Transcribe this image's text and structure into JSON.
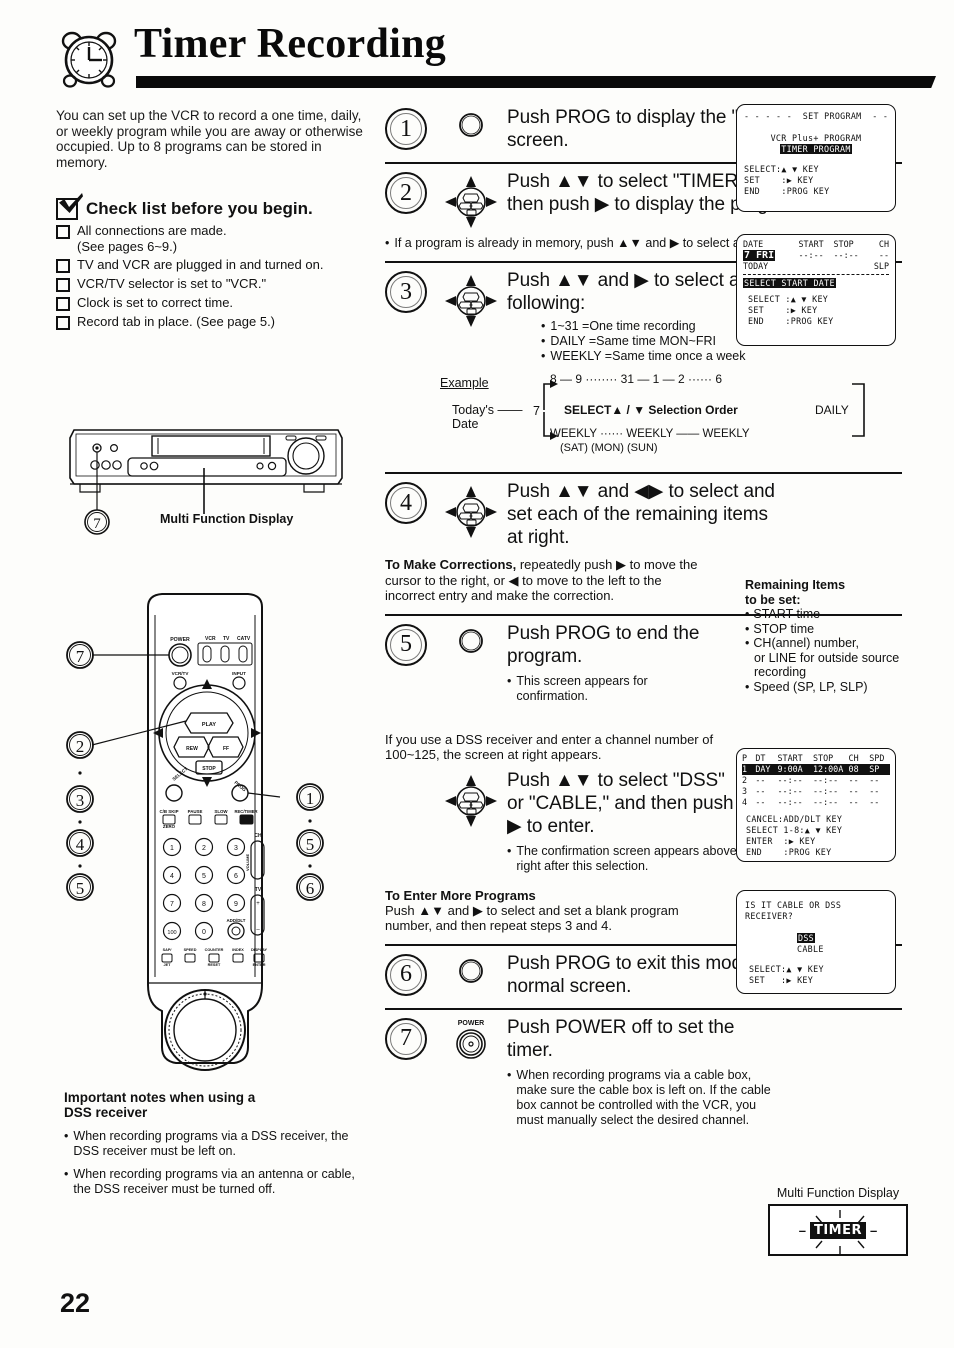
{
  "header": {
    "title": "Timer Recording",
    "icon": "alarm-clock-icon"
  },
  "intro": {
    "paragraph": "You can set up the VCR to record a one time, daily, or weekly program while you are away or otherwise occupied. Up to 8 programs can be stored in memory."
  },
  "checklist": {
    "title": "Check list before you begin.",
    "items": [
      {
        "label": "All connections are made.",
        "sub": "(See pages 6~9.)"
      },
      {
        "label": "TV and VCR are plugged in and turned on.",
        "sub": ""
      },
      {
        "label": "VCR/TV selector is set to \"VCR.\"",
        "sub": ""
      },
      {
        "label": "Clock is set to correct time.",
        "sub": ""
      },
      {
        "label": "Record tab in place. (See page 5.)",
        "sub": ""
      }
    ]
  },
  "vcr_illustration": {
    "callout_label": "Multi Function Display",
    "callout_number": "7"
  },
  "remote_illustration": {
    "callouts": [
      "7",
      "2",
      "3",
      "4",
      "5",
      "1",
      "5",
      "6"
    ],
    "button_labels": [
      "POWER",
      "VCR",
      "TV",
      "CATV",
      "VCR/TV",
      "INPUT",
      "PLAY",
      "REW",
      "FF",
      "STOP",
      "SELECT",
      "PROG",
      "C/B SKIP ZERO",
      "PAUSE",
      "SLOW",
      "REC/TIMER",
      "CH",
      "VOLUME",
      "TV",
      "ADD/DLT",
      "SAP/JET",
      "SPEED",
      "COUNTER RESET",
      "INDEX",
      "DISPLAY ENTER"
    ],
    "keypad": [
      "1",
      "2",
      "3",
      "4",
      "5",
      "6",
      "7",
      "8",
      "9",
      "100",
      "0"
    ]
  },
  "important_notes": {
    "title_line1": "Important notes when using a",
    "title_line2": "DSS receiver",
    "items": [
      "When recording programs via a DSS receiver, the DSS receiver must be left on.",
      "When recording programs via an antenna or cable, the DSS receiver must be turned off."
    ]
  },
  "page_number": "22",
  "steps": [
    {
      "number": "1",
      "icon": "prog-button-icon",
      "heading": "Push PROG to display the \"SET PROGRAM\" screen."
    },
    {
      "number": "2",
      "icon": "dpad-icon",
      "heading": "Push ▲▼ to select \"TIMER PROGRAM,\" and then push ▶ to display the program screen.",
      "note": "If a program is already in memory, push ▲▼ and ▶ to select an unused program number."
    },
    {
      "number": "3",
      "icon": "dpad-icon",
      "heading": "Push ▲▼ and ▶ to select and set one of the following:",
      "bullets": [
        "1~31 =One time recording",
        "DAILY =Same time MON~FRI",
        "WEEKLY =Same time once a week"
      ],
      "example": {
        "label": "Example",
        "todays_date_line1": "Today's",
        "todays_date_line2": "Date",
        "start_value": "7",
        "top_sequence": "8 — 9 ········ 31 — 1 — 2 ······ 6",
        "middle_label": "SELECT▲ / ▼ Selection Order",
        "daily_label": "DAILY",
        "bottom_sequence": "WEEKLY ······ WEEKLY —— WEEKLY",
        "bottom_sequence_sub": "(SAT)              (MON)            (SUN)"
      }
    },
    {
      "number": "4",
      "icon": "dpad-icon",
      "heading": "Push ▲▼ and ◀▶ to select and set each of the remaining items at right.",
      "correction_bold": "To Make Corrections,",
      "correction_text": " repeatedly push ▶ to move the cursor to the right, or ◀ to move to the left to the incorrect entry and make the correction."
    },
    {
      "number": "5",
      "icon": "prog-button-icon",
      "heading": "Push PROG to end the program.",
      "note": "This screen appears for confirmation.",
      "dss_paragraph": "If you use a DSS receiver and enter a channel number of 100~125, the screen at right appears.",
      "dss_heading": "Push ▲▼ to select \"DSS\" or \"CABLE,\" and then push ▶ to enter.",
      "dss_note": "The confirmation screen appears above right after this selection.",
      "more_programs_title": "To Enter More Programs",
      "more_programs_text": "Push ▲▼ and ▶ to select and set a blank program number, and then repeat steps 3 and 4."
    },
    {
      "number": "6",
      "icon": "prog-button-icon",
      "heading": "Push PROG to exit this mode and return to the normal screen."
    },
    {
      "number": "7",
      "icon": "power-button-icon",
      "icon_label": "POWER",
      "heading": "Push POWER off to set the timer.",
      "note": "When recording programs via a cable box, make sure the cable box is left on. If the cable box cannot be controlled with the VCR, you must manually select the desired channel."
    }
  ],
  "remaining_items": {
    "title_line1": "Remaining Items",
    "title_line2": "to be set:",
    "items": [
      {
        "text": "START time",
        "cont": ""
      },
      {
        "text": "STOP time",
        "cont": ""
      },
      {
        "text": "CH(annel) number,",
        "cont": "or LINE for outside source recording"
      },
      {
        "text": "Speed (SP, LP, SLP)",
        "cont": ""
      }
    ]
  },
  "osd_set_program": {
    "title": "- - - - -  SET PROGRAM  - - - - -",
    "option_1": "VCR Plus+ PROGRAM",
    "option_2_highlighted": "TIMER PROGRAM",
    "keys": [
      "SELECT:▲ ▼ KEY",
      "SET    :▶ KEY",
      "END    :PROG KEY"
    ]
  },
  "osd_date_screen": {
    "columns": [
      "DATE",
      "START",
      "STOP",
      "CH"
    ],
    "row_date_highlighted": "7 FRI",
    "row_start": "--:--",
    "row_stop": "--:--",
    "row_ch": "--",
    "today_label": "TODAY",
    "speed": "SLP",
    "status_highlighted": "SELECT START DATE",
    "keys": [
      "SELECT :▲ ▼ KEY",
      "SET    :▶ KEY",
      "END    :PROG KEY"
    ]
  },
  "osd_program_list": {
    "columns": [
      "P",
      "DT",
      "START",
      "STOP",
      "CH",
      "SPD"
    ],
    "rows": [
      {
        "p": "1",
        "dt": "DAY",
        "start": "9:00A",
        "stop": "12:00A",
        "ch": "08",
        "spd": "SP",
        "highlighted": true
      },
      {
        "p": "2",
        "dt": "--",
        "start": "--:--",
        "stop": "--:--",
        "ch": "--",
        "spd": "--",
        "highlighted": false
      },
      {
        "p": "3",
        "dt": "--",
        "start": "--:--",
        "stop": "--:--",
        "ch": "--",
        "spd": "--",
        "highlighted": false
      },
      {
        "p": "4",
        "dt": "--",
        "start": "--:--",
        "stop": "--:--",
        "ch": "--",
        "spd": "--",
        "highlighted": false
      }
    ],
    "keys": [
      "CANCEL:ADD/DLT KEY",
      "SELECT 1-8:▲ ▼ KEY",
      "ENTER  :▶ KEY",
      "END    :PROG KEY"
    ]
  },
  "osd_dss_cable": {
    "question_line1": "IS IT CABLE OR DSS",
    "question_line2": "RECEIVER?",
    "option_highlighted": "DSS",
    "option_2": "CABLE",
    "keys": [
      "SELECT:▲ ▼ KEY",
      "SET   :▶ KEY"
    ]
  },
  "mfd_right": {
    "label": "Multi Function Display",
    "indicator": "TIMER"
  },
  "colors": {
    "ink": "#111111",
    "paper": "#fdfdfb"
  }
}
